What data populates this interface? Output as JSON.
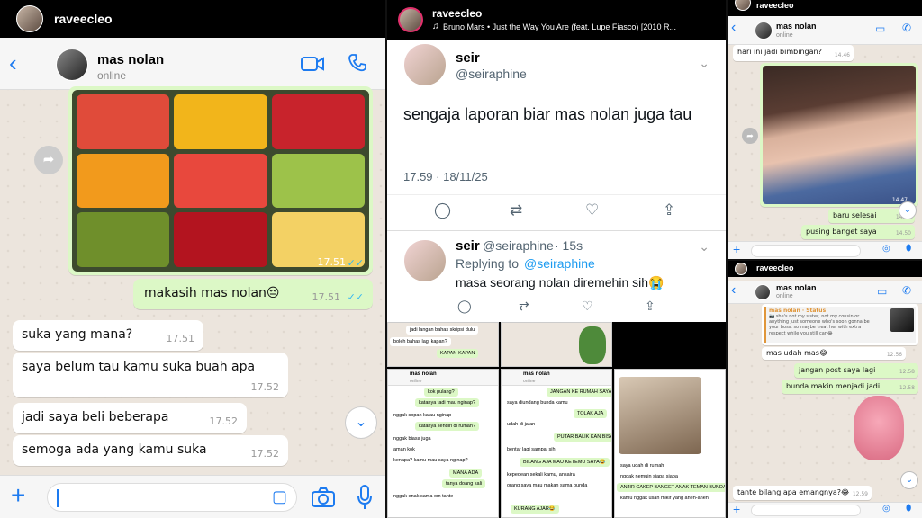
{
  "left": {
    "top_username": "raveecleo",
    "contact_name": "mas nolan",
    "contact_status": "online",
    "photo_time": "17.51",
    "messages": [
      {
        "text": "makasih mas nolan😔",
        "time": "17.51",
        "dir": "out"
      },
      {
        "text": "suka yang mana?",
        "time": "17.51",
        "dir": "in"
      },
      {
        "text": "saya belum tau kamu suka buah apa",
        "time": "17.52",
        "dir": "in"
      },
      {
        "text": "jadi saya beli beberapa",
        "time": "17.52",
        "dir": "in"
      },
      {
        "text": "semoga ada yang kamu suka",
        "time": "17.52",
        "dir": "in"
      }
    ]
  },
  "middle": {
    "username": "raveecleo",
    "music": "Bruno Mars • Just the Way You Are (feat. Lupe Fiasco) [2010 R...",
    "tweet1": {
      "name": "seir",
      "handle": "@seiraphine",
      "text": "sengaja laporan biar mas nolan juga tau",
      "meta": "17.59 · 18/11/25"
    },
    "tweet2": {
      "name": "seir",
      "handle": "@seiraphine",
      "age": "· 15s",
      "reply_prefix": "Replying to",
      "reply_to": "@seiraphine",
      "text": "masa seorang nolan diremehin sih😭"
    },
    "grid": {
      "a": [
        "jadi langan bahas skripsi dulu",
        "boleh bahas lagi kapan?",
        "KAPAN-KAPAN"
      ],
      "b": [
        "kok pulang?",
        "katanya tadi mau nginap?",
        "nggak sopan kalau nginap",
        "katanya sendiri di rumah?",
        "nggak biasa juga",
        "aman kok",
        "kenapa? kamu mau saya nginap?",
        "MANA ADA",
        "tanya doang kali",
        "nggak enak sama om tante"
      ],
      "c": [
        "JANGAN KE RUMAH SAYA?",
        "saya diundang bunda kamu",
        "TOLAK AJA",
        "udah di jalan",
        "PUTAR BALIK KAN BISA",
        "bentar lagi sampai sih",
        "BILANG AJA MAU KETEMU SAYA😂",
        "kepedean sekali kamu, ansaira",
        "orang saya mau makan sama bunda",
        "KURANG AJAR😂"
      ],
      "d": [
        "saya udah di rumah",
        "nggak nemuin siapa siapa",
        "ANJIR CAKEP BANGET ANAK TEMAN BUNDA😂",
        "kamu nggak usah mikir yang aneh-aneh"
      ],
      "contact": "mas nolan",
      "status": "online"
    }
  },
  "right_top": {
    "username": "raveecleo",
    "contact_name": "mas nolan",
    "contact_status": "online",
    "messages": [
      {
        "text": "hari ini jadi bimbingan?",
        "time": "14.46",
        "dir": "in"
      },
      {
        "text": "baru selesai",
        "time": "14.50",
        "dir": "out"
      },
      {
        "text": "pusing banget saya",
        "time": "14.50",
        "dir": "out"
      }
    ],
    "photo_time": "14.47"
  },
  "right_bottom": {
    "username": "raveecleo",
    "contact_name": "mas nolan",
    "contact_status": "online",
    "quote_title": "mas nolan · Status",
    "quote_text": "📷 she's not my sister, not my cousin or anything just someone who's soon gonna be your boss. so maybe treat her with extra respect while you still can😂",
    "messages": [
      {
        "text": "mas udah mas😂",
        "time": "12.56",
        "dir": "in"
      },
      {
        "text": "jangan post saya lagi",
        "time": "12.58",
        "dir": "out"
      },
      {
        "text": "bunda makin menjadi jadi",
        "time": "12.58",
        "dir": "out"
      },
      {
        "text": "tante bilang apa emangnya?😂",
        "time": "12.59",
        "dir": "in"
      }
    ]
  }
}
